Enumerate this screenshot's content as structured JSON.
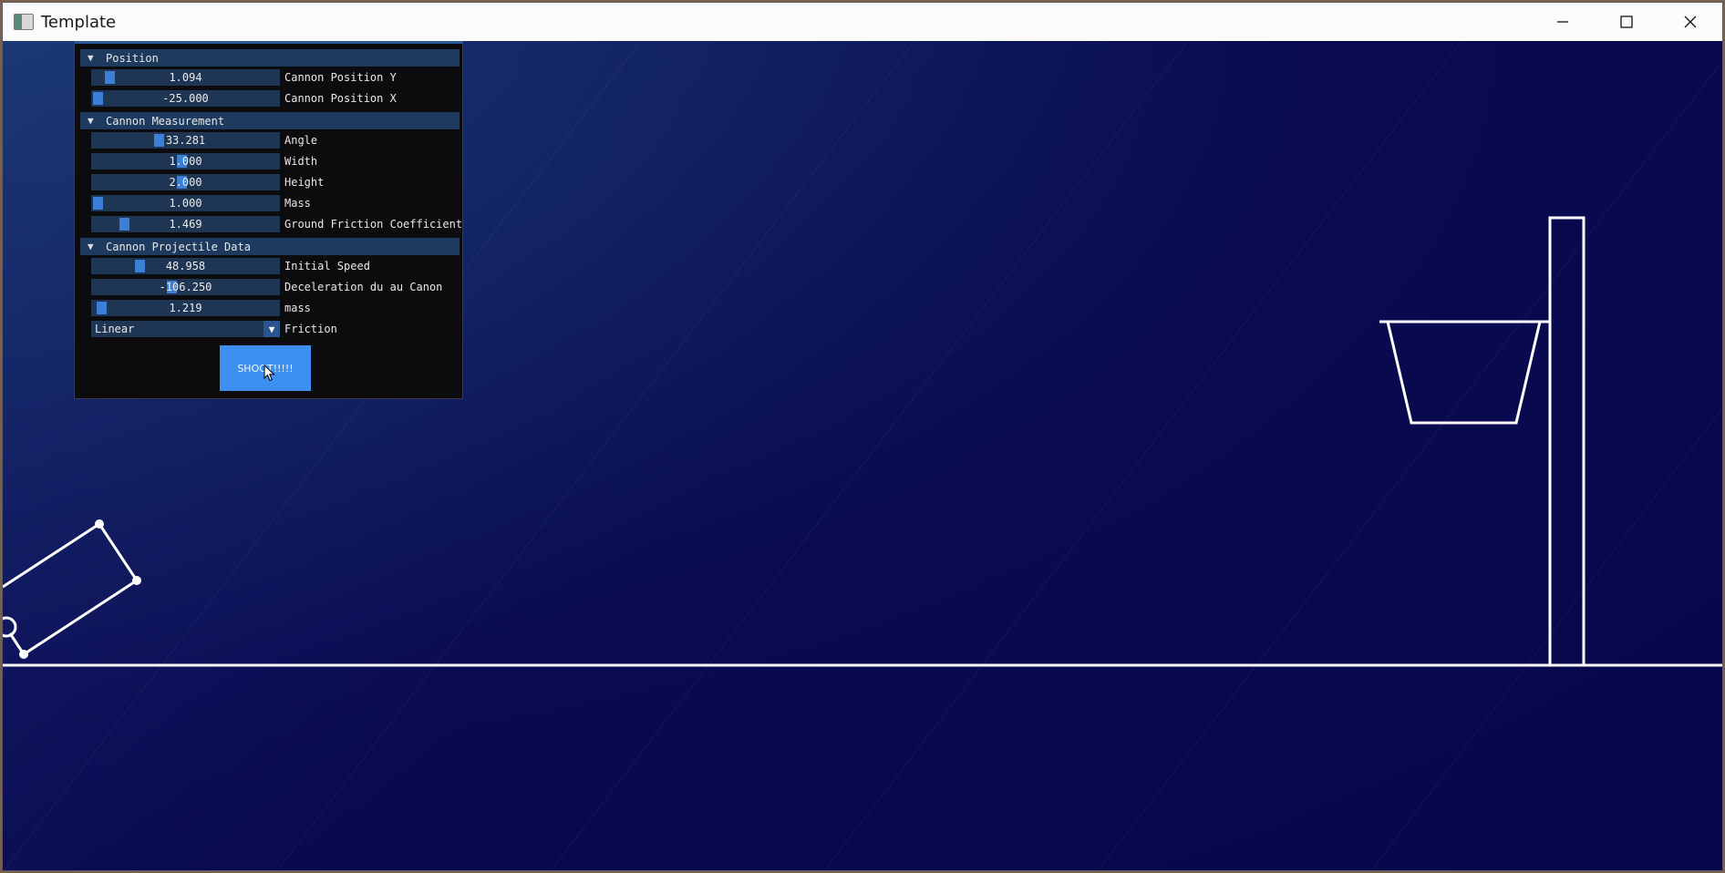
{
  "window": {
    "title": "Template"
  },
  "controls": {
    "minimize": "─",
    "maximize": "☐",
    "close": "✕"
  },
  "sections": [
    {
      "title": "Position"
    },
    {
      "title": "Cannon Measurement"
    },
    {
      "title": "Cannon Projectile Data"
    }
  ],
  "fields": [
    {
      "value": "1.094",
      "label": "Cannon Position Y",
      "fraction": 0.07
    },
    {
      "value": "-25.000",
      "label": "Cannon Position X",
      "fraction": 0.0
    },
    {
      "value": "33.281",
      "label": "Angle",
      "fraction": 0.35
    },
    {
      "value": "1.000",
      "label": "Width",
      "fraction": 0.48
    },
    {
      "value": "2.000",
      "label": "Height",
      "fraction": 0.48
    },
    {
      "value": "1.000",
      "label": "Mass",
      "fraction": 0.0
    },
    {
      "value": "1.469",
      "label": "Ground Friction Coefficient",
      "fraction": 0.15
    },
    {
      "value": "48.958",
      "label": "Initial Speed",
      "fraction": 0.24
    },
    {
      "value": "-106.250",
      "label": "Deceleration du au Canon",
      "fraction": 0.42
    },
    {
      "value": "1.219",
      "label": "mass",
      "fraction": 0.02
    }
  ],
  "friction": {
    "value": "Linear",
    "label": "Friction"
  },
  "shoot_button": {
    "label": "SHOOT!!!!!"
  },
  "colors": {
    "background": "#0a0a4a",
    "slider_bg": "#1e3553",
    "grab": "#3b7fd6",
    "section_header": "#1e3a5f",
    "button": "#3d8ff0",
    "lines": "#ffffff"
  }
}
